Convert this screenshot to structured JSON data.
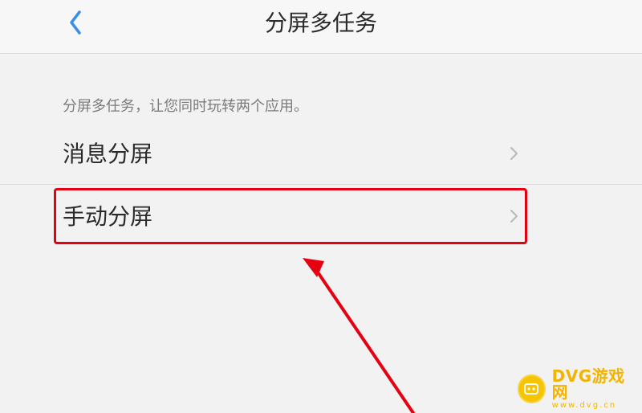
{
  "header": {
    "back_icon": "chevron-left-icon",
    "title": "分屏多任务"
  },
  "main": {
    "description": "分屏多任务，让您同时玩转两个应用。",
    "items": [
      {
        "label": "消息分屏",
        "icon": "chevron-right-icon"
      },
      {
        "label": "手动分屏",
        "icon": "chevron-right-icon"
      }
    ]
  },
  "annotation": {
    "highlight_color": "#e50012",
    "arrow_color": "#e50012"
  },
  "watermark": {
    "brand": "DVG游戏网",
    "domain": "www.dvg.cn",
    "logo_icon": "gamepad-icon",
    "logo_color": "#f6c400"
  },
  "colors": {
    "accent": "#3b8ee9",
    "background": "#f0f0f0",
    "header_background": "#f7f7f7"
  }
}
